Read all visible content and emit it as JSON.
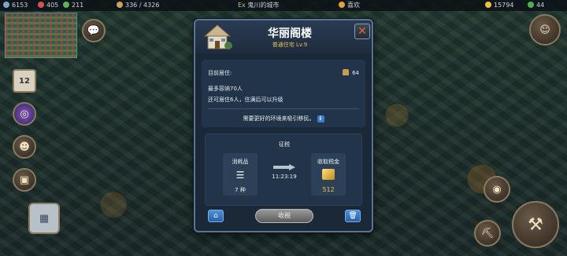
{
  "topbar": {
    "stat1": "6153",
    "stat2": "405",
    "stat3": "211",
    "population": "336 / 4326",
    "city_name": "鬼川的城市",
    "city_prefix": "Ex",
    "mood": "喜欢",
    "gold": "15794",
    "gems": "44"
  },
  "calendar": {
    "day": "12"
  },
  "dialog": {
    "title": "华丽阁楼",
    "subtitle": "普通住宅 Lv.9",
    "current_residents_label": "目前居住:",
    "current_residents_value": "64",
    "max_capacity": "最多容纳70人",
    "remaining": "还可居住6人，住满后可以升级",
    "hint": "需要更好的环境来吸引移民。",
    "info_icon": "i",
    "close_icon": "✕",
    "tax": {
      "title": "征税",
      "consumables_label": "消耗品",
      "consumables_value": "7 种",
      "timer": "11:23:19",
      "collect_label": "收取税金",
      "collect_value": "512"
    },
    "collect_button": "收税",
    "left_button_icon": "upgrade-icon",
    "right_button_icon": "trash-icon"
  },
  "colors": {
    "title_gold": "#e2c25a",
    "gold_value": "#f0c848",
    "close_orange": "#e06a30",
    "blue_button": "#3b7fd0"
  }
}
